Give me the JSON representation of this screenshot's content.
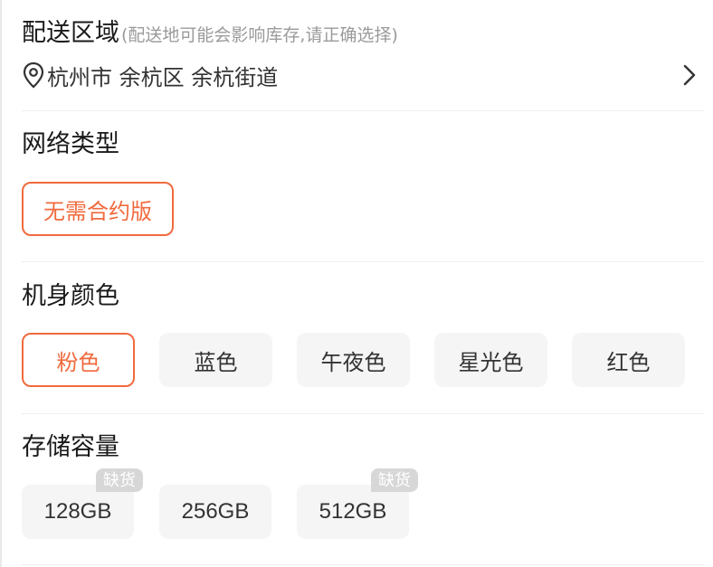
{
  "delivery": {
    "title": "配送区域",
    "hint": "(配送地可能会影响库存,请正确选择)",
    "address": "杭州市 余杭区 余杭街道"
  },
  "network": {
    "title": "网络类型",
    "options": [
      {
        "label": "无需合约版",
        "selected": true
      }
    ]
  },
  "color": {
    "title": "机身颜色",
    "options": [
      {
        "label": "粉色",
        "selected": true
      },
      {
        "label": "蓝色",
        "selected": false
      },
      {
        "label": "午夜色",
        "selected": false
      },
      {
        "label": "星光色",
        "selected": false
      },
      {
        "label": "红色",
        "selected": false
      }
    ]
  },
  "storage": {
    "title": "存储容量",
    "options": [
      {
        "label": "128GB",
        "badge": "缺货"
      },
      {
        "label": "256GB",
        "badge": ""
      },
      {
        "label": "512GB",
        "badge": "缺货"
      }
    ]
  },
  "colors": {
    "accent": "#f06a3e",
    "option_bg": "#f5f5f5",
    "badge_bg": "#d7d7d7"
  },
  "icons": {
    "location": "location-pin-icon",
    "chevron": "chevron-right-icon"
  }
}
